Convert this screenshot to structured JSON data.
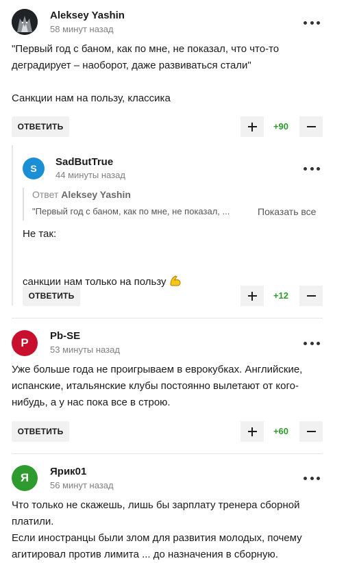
{
  "comments": [
    {
      "author": "Aleksey Yashin",
      "time": "58 минут назад",
      "text": "\"Первый год с баном, как по мне, не показал, что что-то деградирует – наоборот, даже развиваться стали\"\n\nСанкции нам на пользу, классика",
      "reply_label": "ОТВЕТИТЬ",
      "score": "+90",
      "avatar_color": "#1e2124"
    },
    {
      "author": "SadButTrue",
      "avatar_letter": "S",
      "avatar_color": "#1a8fd6",
      "time": "44 минуты назад",
      "quote_prefix": "Ответ",
      "quote_author": "Aleksey Yashin",
      "quote_text": "\"Первый год с баном, как по мне, не показал, ...",
      "show_all": "Показать все",
      "text_line1": "Не так:",
      "text_line2": "санкции нам только на пользу",
      "reply_label": "ОТВЕТИТЬ",
      "score": "+12",
      "emoji_icon": "flexed-biceps-icon"
    },
    {
      "author": "Pb-SE",
      "avatar_letter": "P",
      "avatar_color": "#c8102e",
      "time": "53 минуты назад",
      "text": "Уже больше года не проигрываем в еврокубках. Английские, испанские, итальянские клубы постоянно вылетают от кого-нибудь, а у нас пока все в строю.",
      "reply_label": "ОТВЕТИТЬ",
      "score": "+60"
    },
    {
      "author": "Ярик01",
      "avatar_letter": "Я",
      "avatar_color": "#2e9b2e",
      "time": "56 минут назад",
      "text": "Что только не скажешь, лишь бы зарплату тренера сборной платили.\nЕсли иностранцы были злом для развития молодых, почему агитировал против лимита ... до назначения в сборную."
    }
  ],
  "colors": {
    "score_positive": "#2e9b2e",
    "button_bg": "#f1f1f1"
  }
}
